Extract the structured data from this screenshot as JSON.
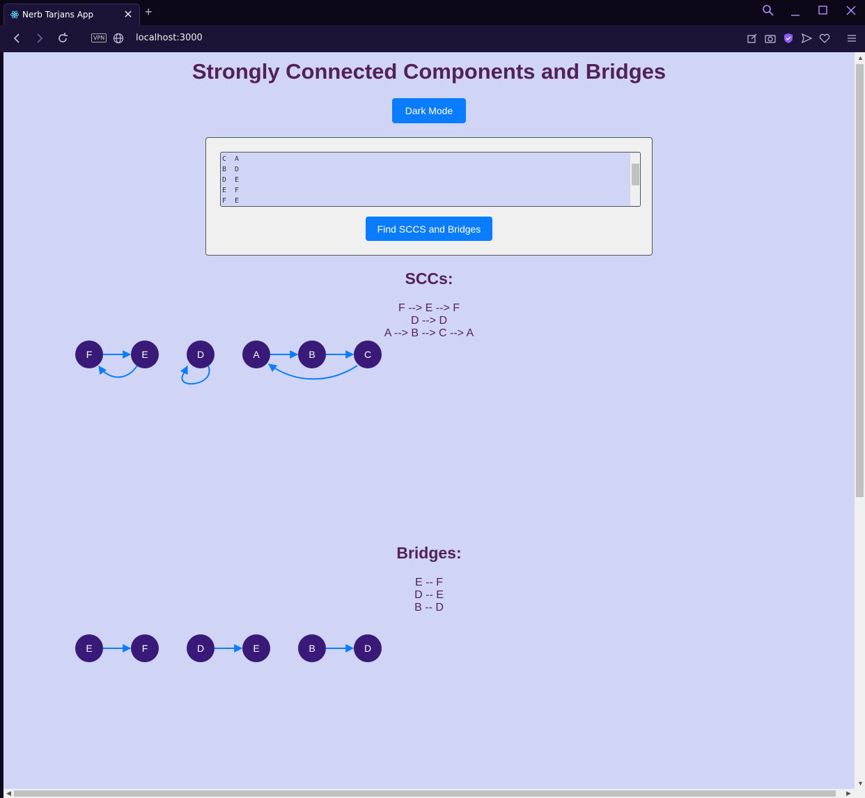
{
  "browser": {
    "tab_title": "Nerb Tarjans App",
    "url": "localhost:3000",
    "vpn_label": "VPN"
  },
  "page": {
    "title": "Strongly Connected Components and Bridges",
    "dark_mode_label": "Dark Mode",
    "edges_input": "C  A\nB  D\nD  E\nE  F\nF  E",
    "find_button_label": "Find SCCS and Bridges"
  },
  "sccs": {
    "heading": "SCCs:",
    "lines": [
      "F --> E --> F",
      "D --> D",
      "A --> B --> C --> A"
    ],
    "nodes": [
      "F",
      "E",
      "D",
      "A",
      "B",
      "C"
    ]
  },
  "bridges": {
    "heading": "Bridges:",
    "lines": [
      "E -- F",
      "D -- E",
      "B -- D"
    ],
    "nodes": [
      "E",
      "F",
      "D",
      "E",
      "B",
      "D"
    ]
  },
  "colors": {
    "background": "#d1d5f5",
    "heading": "#52215a",
    "button": "#0a7cff",
    "node": "#3a1a78",
    "edge": "#0a7cff"
  }
}
